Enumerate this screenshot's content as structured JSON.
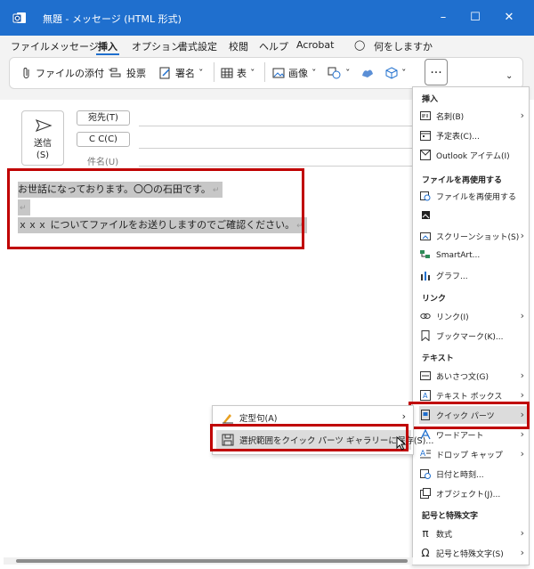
{
  "window": {
    "title": "無題 - メッセージ (HTML 形式)",
    "minimize_icon": "minimize-icon",
    "maximize_icon": "maximize-icon",
    "close_icon": "close-icon"
  },
  "tabs": [
    {
      "label": "ファイル"
    },
    {
      "label": "メッセージ"
    },
    {
      "label": "挿入",
      "active": true
    },
    {
      "label": "オプション"
    },
    {
      "label": "書式設定"
    },
    {
      "label": "校閲"
    },
    {
      "label": "ヘルプ"
    },
    {
      "label": "Acrobat"
    }
  ],
  "search": {
    "label": "何をしますか",
    "icon": "lightbulb-icon"
  },
  "toolbar": {
    "attach_label": "ファイルの添付",
    "poll_label": "投票",
    "signature_label": "署名",
    "table_label": "表",
    "image_label": "画像",
    "more_label": "..."
  },
  "compose": {
    "send_label_line1": "送信",
    "send_label_line2": "(S)",
    "to_label": "宛先(T)",
    "cc_label": "C C(C)",
    "subject_label": "件名(U)",
    "body_lines": [
      "お世話になっております。〇〇の石田です。",
      "",
      "ｘｘｘ についてファイルをお送りしますのでご確認ください。"
    ],
    "pilcrow": "↵"
  },
  "panel": {
    "sections": {
      "insert": "挿入",
      "reuse": "ファイルを再使用する",
      "link": "リンク",
      "text": "テキスト",
      "symbols": "記号と特殊文字"
    },
    "items": {
      "business_card": "名刺(B)",
      "calendar": "予定表(C)...",
      "outlook_item": "Outlook アイテム(I)",
      "reuse_file": "ファイルを再使用する",
      "screenshot": "スクリーンショット(S)",
      "smartart": "SmartArt...",
      "chart": "グラフ...",
      "link": "リンク(I)",
      "bookmark": "ブックマーク(K)...",
      "greeting": "あいさつ文(G)",
      "textbox": "テキスト ボックス",
      "quick_parts": "クイック パーツ",
      "wordart": "ワードアート",
      "dropcap": "ドロップ キャップ",
      "datetime": "日付と時刻...",
      "object": "オブジェクト(J)...",
      "equation": "数式",
      "symbol": "記号と特殊文字(S)"
    }
  },
  "submenu": {
    "autotext": "定型句(A)",
    "save_selection": "選択範囲をクイック パーツ ギャラリーに保存(S)..."
  },
  "colors": {
    "titlebar": "#1f6fce",
    "highlight_box": "#c00000",
    "selection": "#c7c7c7"
  }
}
